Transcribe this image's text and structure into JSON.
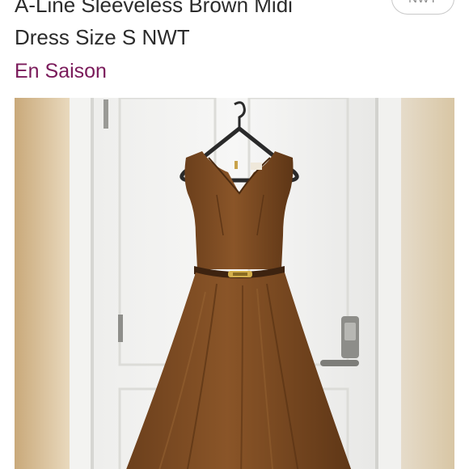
{
  "listing": {
    "title_line1": "A-Line Sleeveless Brown Midi",
    "title_line2": "Dress Size S NWT",
    "condition_badge": "NWT",
    "brand": "En Saison"
  },
  "photo": {
    "alt": "Brown sleeveless A-line midi dress on hanger against door"
  },
  "colors": {
    "brand_link": "#7a1a5a",
    "title_text": "#2b2b2b",
    "dress": "#7a4a22"
  }
}
